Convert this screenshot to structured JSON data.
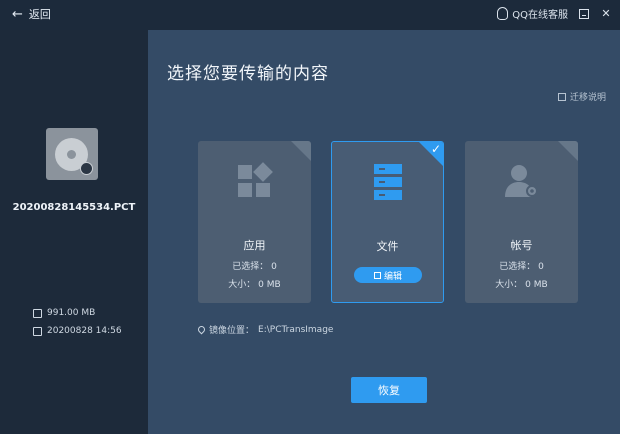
{
  "titlebar": {
    "back_label": "返回",
    "qq_label": "QQ在线客服"
  },
  "sidebar": {
    "disk_name": "20200828145534.PCT",
    "size": "991.00 MB",
    "date": "20200828 14:56"
  },
  "main": {
    "heading": "选择您要传输的内容",
    "help_label": "迁移说明",
    "cards": [
      {
        "title": "应用",
        "selected_label": "已选择：",
        "selected_value": "0",
        "size_label": "大小：",
        "size_value": "0 MB",
        "checked": false
      },
      {
        "title": "文件",
        "edit_label": "编辑",
        "checked": true
      },
      {
        "title": "帐号",
        "selected_label": "已选择：",
        "selected_value": "0",
        "size_label": "大小：",
        "size_value": "0 MB",
        "checked": false
      }
    ],
    "mirror_label": "镜像位置：",
    "mirror_path": "E:\\PCTransImage",
    "restore_label": "恢复"
  },
  "colors": {
    "accent": "#2f9bf0",
    "main_bg": "#344b66",
    "sidebar_bg": "#1d2a3a",
    "card_bg": "#4d5e72"
  }
}
